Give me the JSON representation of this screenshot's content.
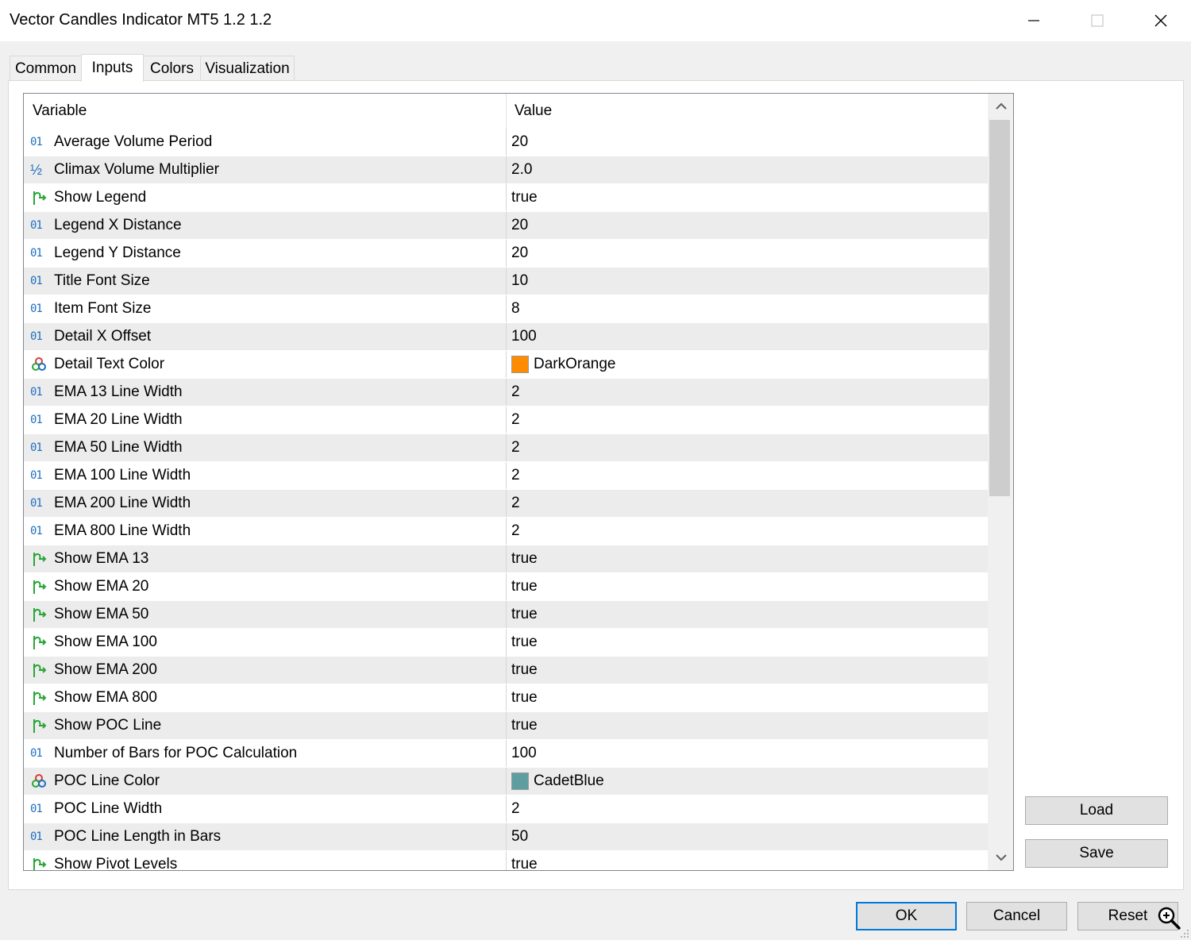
{
  "window": {
    "title": "Vector Candles Indicator MT5 1.2 1.2"
  },
  "tabs": [
    {
      "label": "Common",
      "active": false
    },
    {
      "label": "Inputs",
      "active": true
    },
    {
      "label": "Colors",
      "active": false
    },
    {
      "label": "Visualization",
      "active": false
    }
  ],
  "grid": {
    "headers": {
      "variable": "Variable",
      "value": "Value"
    },
    "rows": [
      {
        "type": "int",
        "variable": "Average Volume Period",
        "value": "20"
      },
      {
        "type": "double",
        "variable": "Climax Volume Multiplier",
        "value": "2.0"
      },
      {
        "type": "bool",
        "variable": "Show Legend",
        "value": "true"
      },
      {
        "type": "int",
        "variable": "Legend X Distance",
        "value": "20"
      },
      {
        "type": "int",
        "variable": "Legend Y Distance",
        "value": "20"
      },
      {
        "type": "int",
        "variable": "Title Font Size",
        "value": "10"
      },
      {
        "type": "int",
        "variable": "Item Font Size",
        "value": "8"
      },
      {
        "type": "int",
        "variable": "Detail X Offset",
        "value": "100"
      },
      {
        "type": "color",
        "variable": "Detail Text Color",
        "value": "DarkOrange",
        "swatch": "#ff8c00"
      },
      {
        "type": "int",
        "variable": "EMA 13 Line Width",
        "value": "2"
      },
      {
        "type": "int",
        "variable": "EMA 20 Line Width",
        "value": "2"
      },
      {
        "type": "int",
        "variable": "EMA 50 Line Width",
        "value": "2"
      },
      {
        "type": "int",
        "variable": "EMA 100 Line Width",
        "value": "2"
      },
      {
        "type": "int",
        "variable": "EMA 200 Line Width",
        "value": "2"
      },
      {
        "type": "int",
        "variable": "EMA 800 Line Width",
        "value": "2"
      },
      {
        "type": "bool",
        "variable": "Show EMA 13",
        "value": "true"
      },
      {
        "type": "bool",
        "variable": "Show EMA 20",
        "value": "true"
      },
      {
        "type": "bool",
        "variable": "Show EMA 50",
        "value": "true"
      },
      {
        "type": "bool",
        "variable": "Show EMA 100",
        "value": "true"
      },
      {
        "type": "bool",
        "variable": "Show EMA 200",
        "value": "true"
      },
      {
        "type": "bool",
        "variable": "Show EMA 800",
        "value": "true"
      },
      {
        "type": "bool",
        "variable": "Show POC Line",
        "value": "true"
      },
      {
        "type": "int",
        "variable": "Number of Bars for POC Calculation",
        "value": "100"
      },
      {
        "type": "color",
        "variable": "POC Line Color",
        "value": "CadetBlue",
        "swatch": "#5f9ea0"
      },
      {
        "type": "int",
        "variable": "POC Line Width",
        "value": "2"
      },
      {
        "type": "int",
        "variable": "POC Line Length in Bars",
        "value": "50"
      },
      {
        "type": "bool",
        "variable": "Show Pivot Levels",
        "value": "true"
      }
    ]
  },
  "icons": {
    "int": "01",
    "double": "½"
  },
  "buttons": {
    "load": "Load",
    "save": "Save",
    "ok": "OK",
    "cancel": "Cancel",
    "reset": "Reset"
  },
  "colors": {
    "accent": "#0078d7",
    "bool_icon": "#2aa53a",
    "int_icon": "#1f6fc0"
  }
}
